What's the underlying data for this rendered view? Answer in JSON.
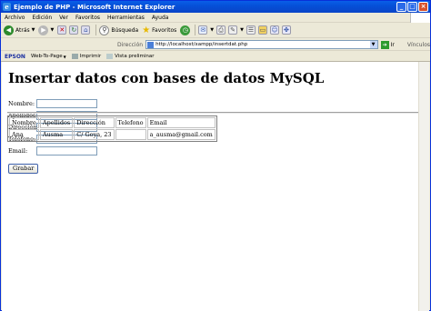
{
  "window": {
    "title": "Ejemplo de PHP - Microsoft Internet Explorer",
    "icon": "ie-icon"
  },
  "menu": [
    "Archivo",
    "Edición",
    "Ver",
    "Favoritos",
    "Herramientas",
    "Ayuda"
  ],
  "toolbar": {
    "back_label": "Atrás",
    "search_label": "Búsqueda",
    "favorites_label": "Favoritos"
  },
  "address": {
    "label": "Dirección",
    "url": "http://localhost/xampp/insertdat.php",
    "go_label": "Ir",
    "links_label": "Vínculos"
  },
  "epson": {
    "brand": "EPSON",
    "web_to_page": "Web-To-Page",
    "print_label": "Imprimir",
    "preview_label": "Vista preliminar"
  },
  "page": {
    "title": "Insertar datos con bases de datos MySQL",
    "fields": [
      {
        "label": "Nombre:",
        "value": ""
      },
      {
        "label": "Apellidos:",
        "value": ""
      },
      {
        "label": "Dirección:",
        "value": ""
      },
      {
        "label": "Teléfono:",
        "value": ""
      },
      {
        "label": "Email:",
        "value": ""
      }
    ],
    "submit_label": "Grabar",
    "table": {
      "headers": [
        "Nombre",
        "Apellidos",
        "Dirección",
        "Telefono",
        "Email"
      ],
      "rows": [
        [
          "Ana",
          "Ausma",
          "C/ Goya, 23",
          "",
          "a_ausma@gmail.com"
        ]
      ]
    }
  },
  "colors": {
    "titlebar": "#0a5fe8",
    "epson_brand": "#1a2fa0"
  }
}
